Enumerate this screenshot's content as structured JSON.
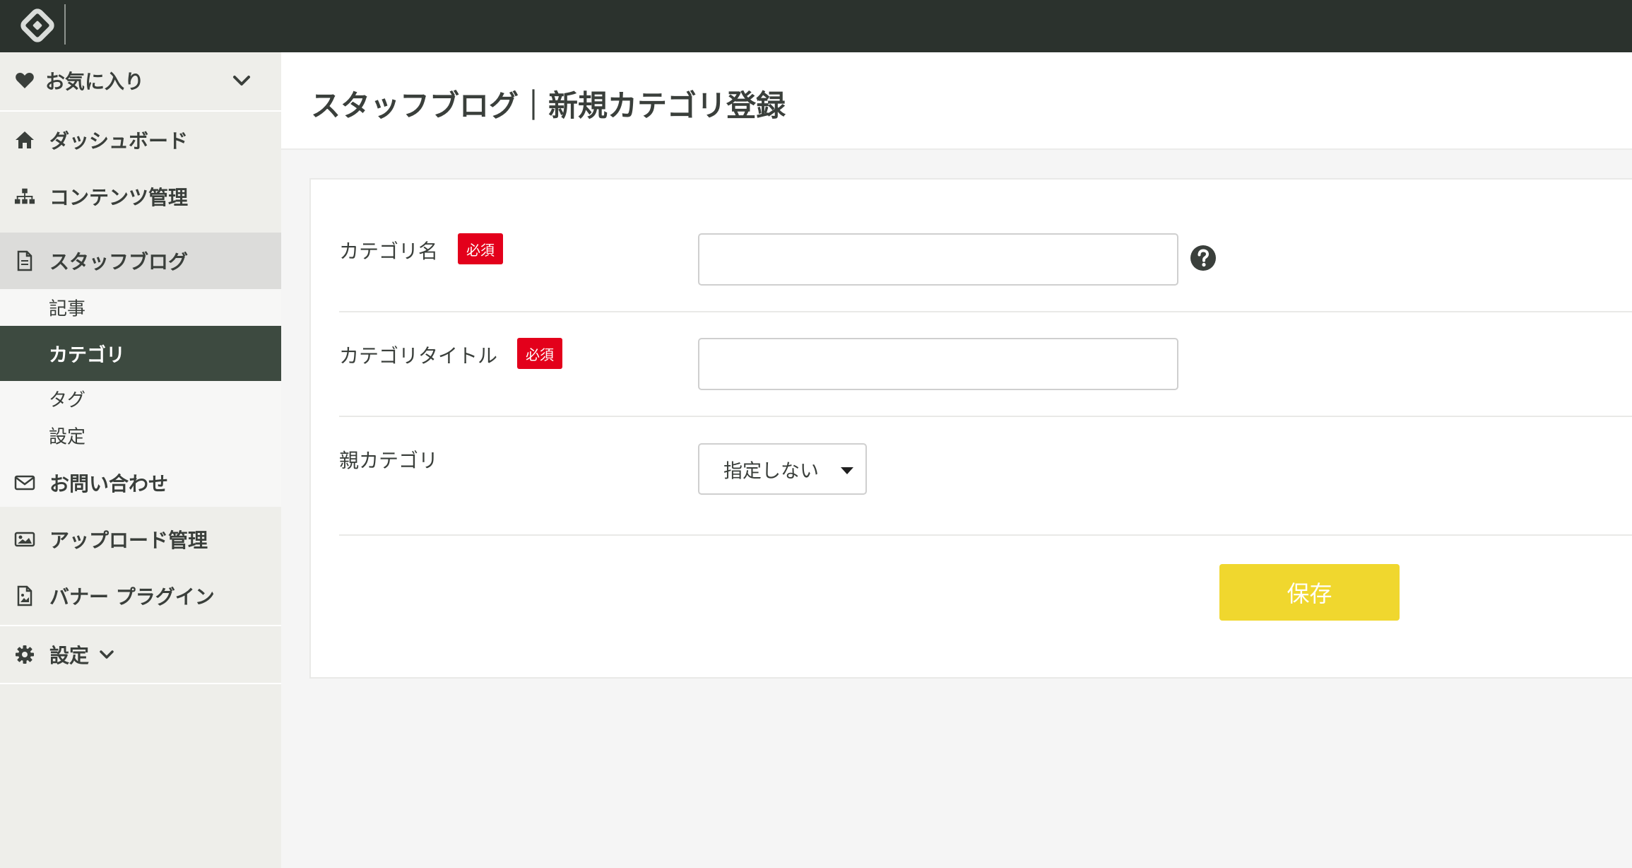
{
  "header": {
    "logo_icon": "logo-icon"
  },
  "sidebar": {
    "favorites": {
      "label": "お気に入り",
      "icon": "heart-icon"
    },
    "items": [
      {
        "label": "ダッシュボード",
        "icon": "home-icon"
      },
      {
        "label": "コンテンツ管理",
        "icon": "sitemap-icon"
      },
      {
        "label": "スタッフブログ",
        "icon": "file-icon"
      },
      {
        "label": "お問い合わせ",
        "icon": "envelope-icon"
      },
      {
        "label": "アップロード管理",
        "icon": "image-icon"
      },
      {
        "label": "バナー プラグイン",
        "icon": "file-image-icon"
      },
      {
        "label": "設定",
        "icon": "gear-icon"
      }
    ],
    "blog_subitems": [
      {
        "label": "記事"
      },
      {
        "label": "カテゴリ",
        "current": true
      },
      {
        "label": "タグ"
      },
      {
        "label": "設定"
      }
    ]
  },
  "page": {
    "title": "スタッフブログ｜新規カテゴリ登録"
  },
  "form": {
    "required_badge": "必須",
    "fields": [
      {
        "label": "カテゴリ名",
        "value": "",
        "required": true
      },
      {
        "label": "カテゴリタイトル",
        "value": "",
        "required": true
      },
      {
        "label": "親カテゴリ",
        "selected": "指定しない"
      }
    ],
    "save_label": "保存"
  },
  "colors": {
    "topbar": "#2b322d",
    "sidebar": "#eeeeea",
    "current_item": "#3d4a40",
    "required": "#e3001b",
    "save_button": "#f0d72e"
  }
}
